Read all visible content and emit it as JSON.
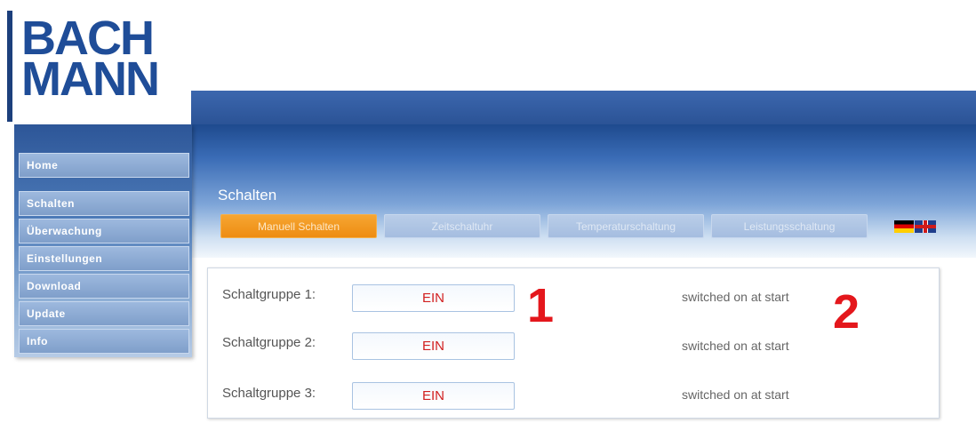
{
  "logo": {
    "line1": "BACH",
    "line2": "MANN"
  },
  "sidebar": {
    "items": [
      {
        "label": "Home"
      },
      {
        "label": "Schalten"
      },
      {
        "label": "Überwachung"
      },
      {
        "label": "Einstellungen"
      },
      {
        "label": "Download"
      },
      {
        "label": "Update"
      },
      {
        "label": "Info"
      }
    ]
  },
  "main": {
    "section_title": "Schalten",
    "tabs": [
      {
        "label": "Manuell Schalten",
        "active": true
      },
      {
        "label": "Zeitschaltuhr"
      },
      {
        "label": "Temperaturschaltung"
      },
      {
        "label": "Leistungsschaltung"
      }
    ],
    "groups": [
      {
        "label": "Schaltgruppe 1:",
        "button": "EIN",
        "status": "switched on at start"
      },
      {
        "label": "Schaltgruppe 2:",
        "button": "EIN",
        "status": "switched on at start"
      },
      {
        "label": "Schaltgruppe 3:",
        "button": "EIN",
        "status": "switched on at start"
      }
    ]
  },
  "annotations": {
    "one": "1",
    "two": "2"
  },
  "colors": {
    "accent": "#ee8d12",
    "brand": "#1f4d98",
    "button_text": "#d22020"
  }
}
